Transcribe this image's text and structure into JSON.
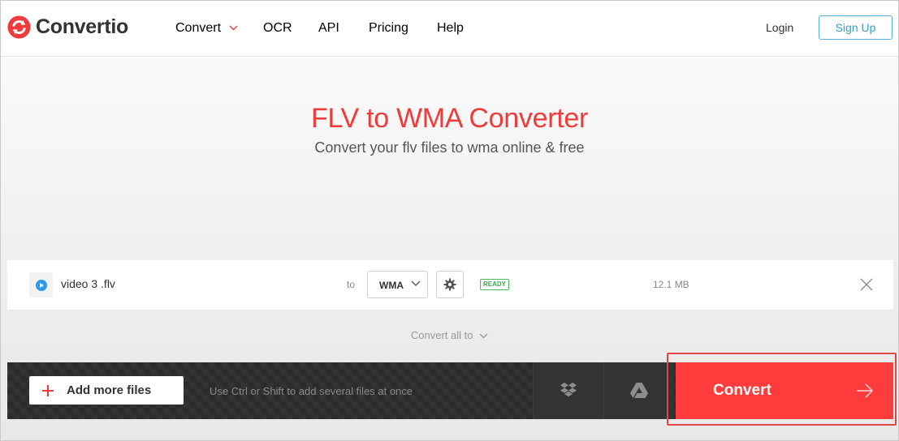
{
  "brand": {
    "name": "Convertio",
    "accent": "#f03b3b"
  },
  "nav": {
    "items": [
      {
        "label": "Convert",
        "has_dropdown": true
      },
      {
        "label": "OCR"
      },
      {
        "label": "API"
      },
      {
        "label": "Pricing"
      },
      {
        "label": "Help"
      }
    ],
    "login_label": "Login",
    "signup_label": "Sign Up"
  },
  "hero": {
    "title": "FLV to WMA Converter",
    "subtitle": "Convert your flv files to wma online & free"
  },
  "file": {
    "name": "video 3 .flv",
    "to_label": "to",
    "format": "WMA",
    "status": "READY",
    "size": "12.1 MB",
    "icon": "play-icon"
  },
  "convert_all_label": "Convert all to",
  "toolbar": {
    "add_files_label": "Add more files",
    "hint": "Use Ctrl or Shift to add several files at once",
    "cloud_icons": [
      "dropbox-icon",
      "google-drive-icon"
    ],
    "convert_label": "Convert"
  }
}
